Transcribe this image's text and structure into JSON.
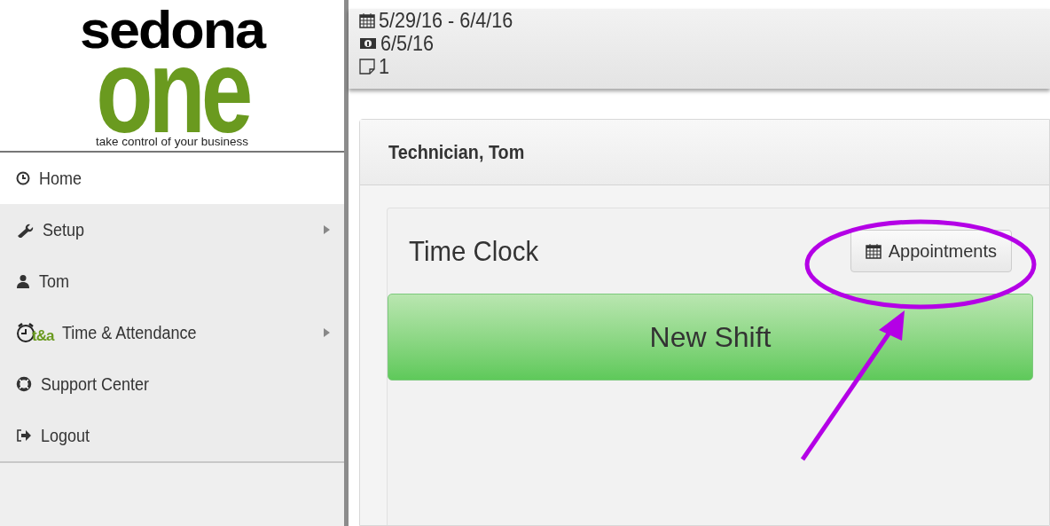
{
  "logo": {
    "brand_top": "sedona",
    "brand_bottom": "one",
    "tagline": "take control of your business"
  },
  "sidebar": {
    "items": [
      {
        "kind": "clock",
        "label": "Home",
        "selected": true,
        "submenu": false
      },
      {
        "kind": "wrench",
        "label": "Setup",
        "selected": false,
        "submenu": true
      },
      {
        "kind": "user",
        "label": "Tom",
        "selected": false,
        "submenu": false
      },
      {
        "kind": "alarm",
        "badge": "t&a",
        "label": "Time & Attendance",
        "selected": false,
        "submenu": true
      },
      {
        "kind": "lifebuoy",
        "label": "Support Center",
        "selected": false,
        "submenu": false
      },
      {
        "kind": "logout",
        "label": "Logout",
        "selected": false,
        "submenu": false
      }
    ]
  },
  "header_info": [
    {
      "kind": "calendar",
      "text": "5/29/16 - 6/4/16"
    },
    {
      "kind": "money",
      "text": "6/5/16"
    },
    {
      "kind": "note",
      "text": "1"
    }
  ],
  "panel": {
    "title": "Technician, Tom",
    "time_clock": {
      "title": "Time Clock",
      "appointments_button": "Appointments",
      "new_shift_button": "New Shift"
    }
  },
  "annotation": {
    "kind": "circle-and-arrow",
    "color": "#b400e6"
  }
}
